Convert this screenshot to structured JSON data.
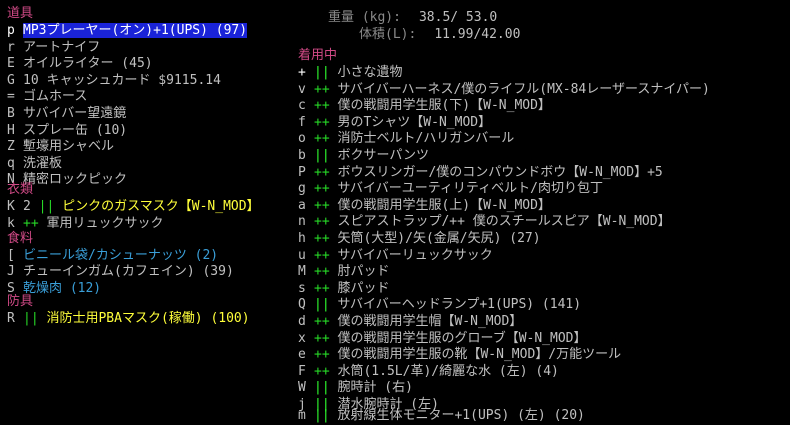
{
  "stats": {
    "weight_label": "重量 (kg):",
    "weight_value": "38.5/ 53.0",
    "volume_label": "体積(L):",
    "volume_value": "11.99/42.00"
  },
  "left": {
    "tools_heading": "道具",
    "tools": [
      {
        "key": "p",
        "text": "MP3プレーヤー(オン)+1(UPS) (97)"
      },
      {
        "key": "r",
        "text": "アートナイフ"
      },
      {
        "key": "E",
        "text": "オイルライター (45)"
      },
      {
        "key": "G",
        "text": "10 キャッシュカード $9115.14"
      },
      {
        "key": "=",
        "text": "ゴムホース"
      },
      {
        "key": "B",
        "text": "サバイバー望遠鏡"
      },
      {
        "key": "H",
        "text": "スプレー缶 (10)"
      },
      {
        "key": "Z",
        "text": "塹壕用シャベル"
      },
      {
        "key": "q",
        "text": "洗濯板"
      },
      {
        "key": "N",
        "text": "精密ロックピック"
      }
    ],
    "clothing_heading": "衣類",
    "clothing": [
      {
        "key": "K",
        "prefix": "2 ",
        "mark": "||",
        "text": "ピンクのガスマスク",
        "tag": "【W-N_MOD】"
      },
      {
        "key": "k",
        "prefix": "",
        "mark": "++",
        "text": "軍用リュックサック",
        "tag": ""
      }
    ],
    "food_heading": "食料",
    "food": [
      {
        "key": "[",
        "text": "ビニール袋/カシューナッツ (2)"
      },
      {
        "key": "J",
        "text": "チューインガム(カフェイン) (39)"
      },
      {
        "key": "S",
        "text": "乾燥肉 (12)"
      }
    ],
    "armor_heading": "防具",
    "armor": [
      {
        "key": "R",
        "mark": "||",
        "text": "消防士用PBAマスク(稼働) (100)"
      }
    ]
  },
  "worn": {
    "heading": "着用中",
    "items": [
      {
        "key": "+",
        "mark": "||",
        "text": "小さな遺物"
      },
      {
        "key": "v",
        "mark": "++",
        "text": "サバイバーハーネス/僕のライフル(MX-84レーザースナイパー)"
      },
      {
        "key": "c",
        "mark": "++",
        "text": "僕の戦闘用学生服(下)【W-N_MOD】"
      },
      {
        "key": "f",
        "mark": "++",
        "text": "男のTシャツ【W-N_MOD】"
      },
      {
        "key": "o",
        "mark": "++",
        "text": "消防士ベルト/ハリガンバール"
      },
      {
        "key": "b",
        "mark": "||",
        "text": "ボクサーパンツ"
      },
      {
        "key": "P",
        "mark": "++",
        "text": "ボウスリンガー/僕のコンパウンドボウ【W-N_MOD】+5"
      },
      {
        "key": "g",
        "mark": "++",
        "text": "サバイバーユーティリティベルト/肉切り包丁"
      },
      {
        "key": "a",
        "mark": "++",
        "text": "僕の戦闘用学生服(上)【W-N_MOD】"
      },
      {
        "key": "n",
        "mark": "++",
        "text": "スピアストラップ/++ 僕のスチールスピア【W-N_MOD】"
      },
      {
        "key": "h",
        "mark": "++",
        "text": "矢筒(大型)/矢(金属/矢尻) (27)"
      },
      {
        "key": "u",
        "mark": "++",
        "text": "サバイバーリュックサック"
      },
      {
        "key": "M",
        "mark": "++",
        "text": "肘パッド"
      },
      {
        "key": "s",
        "mark": "++",
        "text": "膝パッド"
      },
      {
        "key": "Q",
        "mark": "||",
        "text": "サバイバーヘッドランプ+1(UPS) (141)"
      },
      {
        "key": "d",
        "mark": "++",
        "text": "僕の戦闘用学生帽【W-N_MOD】"
      },
      {
        "key": "x",
        "mark": "++",
        "text": "僕の戦闘用学生服のグローブ【W-N_MOD】"
      },
      {
        "key": "e",
        "mark": "++",
        "text": "僕の戦闘用学生服の靴【W-N_MOD】/万能ツール"
      },
      {
        "key": "F",
        "mark": "++",
        "text": "水筒(1.5L/革)/綺麗な水 (左) (4)"
      },
      {
        "key": "W",
        "mark": "||",
        "text": "腕時計 (右)"
      },
      {
        "key": "j",
        "mark": "||",
        "text": "潜水腕時計 (左)"
      },
      {
        "key": "m",
        "mark": "||",
        "text": "放射線生体モニター+1(UPS) (左) (20)"
      }
    ]
  },
  "colors": {
    "background": "#000000",
    "heading": "#d04a86",
    "selection": "#1a23d8",
    "green_mark": "#27d827",
    "yellow_item": "#ffff3a",
    "cyan_item": "#3a9fd8"
  }
}
